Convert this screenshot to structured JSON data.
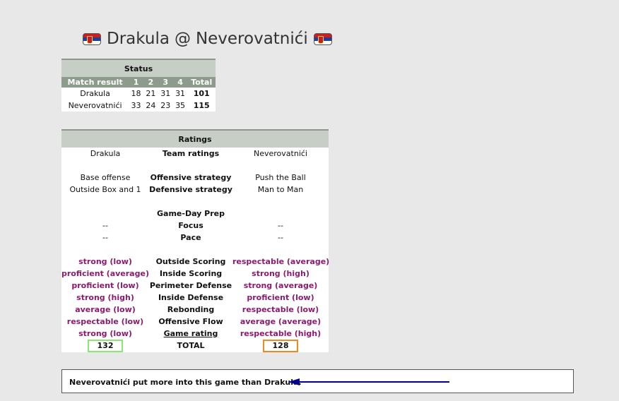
{
  "title": {
    "team_home": "Drakula",
    "separator": "@",
    "team_away": "Neverovatnići",
    "flag": "serbia-flag-icon"
  },
  "status": {
    "header": "Status",
    "columns": [
      "Match result",
      "1",
      "2",
      "3",
      "4",
      "Total"
    ],
    "rows": [
      {
        "team": "Drakula",
        "q": [
          "18",
          "21",
          "31",
          "31"
        ],
        "total": "101"
      },
      {
        "team": "Neverovatnići",
        "q": [
          "33",
          "24",
          "23",
          "35"
        ],
        "total": "115"
      }
    ]
  },
  "ratings": {
    "header": "Ratings",
    "home": "Drakula",
    "away": "Neverovatnići",
    "team_ratings_label": "Team ratings",
    "offensive_strategy": {
      "label": "Offensive strategy",
      "home": "Base offense",
      "away": "Push the Ball"
    },
    "defensive_strategy": {
      "label": "Defensive strategy",
      "home": "Outside Box and 1",
      "away": "Man to Man"
    },
    "gameday_label": "Game-Day Prep",
    "focus": {
      "label": "Focus",
      "home": "--",
      "away": "--"
    },
    "pace": {
      "label": "Pace",
      "home": "--",
      "away": "--"
    },
    "skills": [
      {
        "label": "Outside Scoring",
        "home": "strong (low)",
        "away": "respectable (average)"
      },
      {
        "label": "Inside Scoring",
        "home": "proficient (average)",
        "away": "strong (high)"
      },
      {
        "label": "Perimeter Defense",
        "home": "proficient (low)",
        "away": "strong (average)"
      },
      {
        "label": "Inside Defense",
        "home": "strong (high)",
        "away": "proficient (low)"
      },
      {
        "label": "Rebonding",
        "home": "average (low)",
        "away": "respectable (low)"
      },
      {
        "label": "Offensive Flow",
        "home": "respectable (low)",
        "away": "average (average)"
      },
      {
        "label": "Game rating",
        "home": "strong (low)",
        "away": "respectable (high)"
      }
    ],
    "total": {
      "label": "TOTAL",
      "home": "132",
      "away": "128"
    }
  },
  "note": {
    "text": "Neverovatnići put more into this game than Drakula.",
    "arrow_color": "#00008b"
  },
  "colors": {
    "header_bg": "#c7cec6",
    "subheader_bg": "#8c9b8b",
    "rating_text": "#8b1b6e",
    "home_total_border": "#86ea70",
    "away_total_border": "#f08a1e"
  }
}
